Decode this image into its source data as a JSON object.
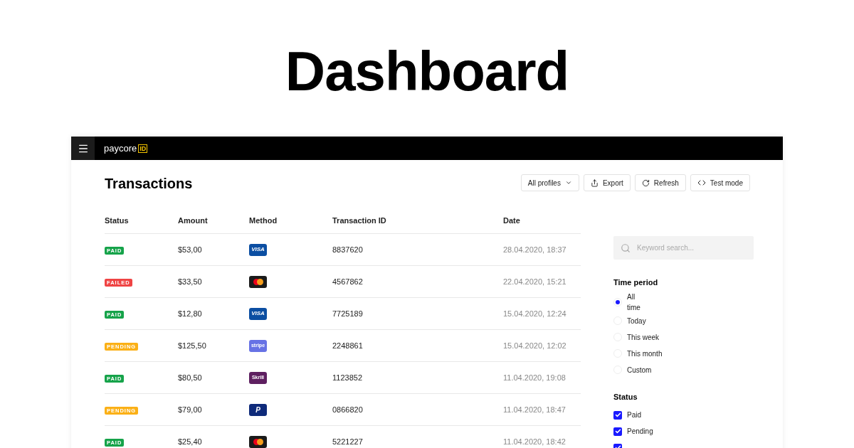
{
  "heading": "Dashboard",
  "app_bar": {
    "brand": "paycore",
    "brand_badge": "ID"
  },
  "page_title": "Transactions",
  "toolbar": [
    {
      "kind": "dropdown",
      "label": "All profiles"
    },
    {
      "kind": "export",
      "label": "Export"
    },
    {
      "kind": "refresh",
      "label": "Refresh"
    },
    {
      "kind": "code",
      "label": "Test mode"
    }
  ],
  "table": {
    "columns": [
      "Status",
      "Amount",
      "Method",
      "Transaction ID",
      "Date"
    ],
    "rows": [
      {
        "status": "PAID",
        "kind": "paid",
        "amount": "$53,00",
        "method": {
          "kind": "visa",
          "label": "VISA"
        },
        "id": "8837620",
        "date": "28.04.2020, 18:37"
      },
      {
        "status": "FAILED",
        "kind": "failed",
        "amount": "$33,50",
        "method": {
          "kind": "mastercard"
        },
        "id": "4567862",
        "date": "22.04.2020, 15:21"
      },
      {
        "status": "PAID",
        "kind": "paid",
        "amount": "$12,80",
        "method": {
          "kind": "visa",
          "label": "VISA"
        },
        "id": "7725189",
        "date": "15.04.2020, 12:24"
      },
      {
        "status": "PENDING",
        "kind": "pending",
        "amount": "$125,50",
        "method": {
          "kind": "stripe",
          "label": "stripe"
        },
        "id": "2248861",
        "date": "15.04.2020, 12:02"
      },
      {
        "status": "PAID",
        "kind": "paid",
        "amount": "$80,50",
        "method": {
          "kind": "skrill",
          "label": "Skrill"
        },
        "id": "1123852",
        "date": "11.04.2020, 19:08"
      },
      {
        "status": "PENDING",
        "kind": "pending",
        "amount": "$79,00",
        "method": {
          "kind": "paypal",
          "label": "P"
        },
        "id": "0866820",
        "date": "11.04.2020, 18:47"
      },
      {
        "status": "PAID",
        "kind": "paid",
        "amount": "$25,40",
        "method": {
          "kind": "mastercard"
        },
        "id": "5221227",
        "date": "11.04.2020, 18:42"
      }
    ]
  },
  "search": {
    "placeholder": "Keyword search..."
  },
  "time_period": {
    "title": "Time period",
    "options": [
      {
        "label": "All time",
        "selected": true
      },
      {
        "label": "Today",
        "selected": false
      },
      {
        "label": "This week",
        "selected": false
      },
      {
        "label": "This month",
        "selected": false
      },
      {
        "label": "Custom",
        "selected": false
      }
    ]
  },
  "status_filter": {
    "title": "Status",
    "options": [
      {
        "label": "Paid",
        "checked": true
      },
      {
        "label": "Pending",
        "checked": true
      },
      {
        "checked": true
      }
    ]
  }
}
